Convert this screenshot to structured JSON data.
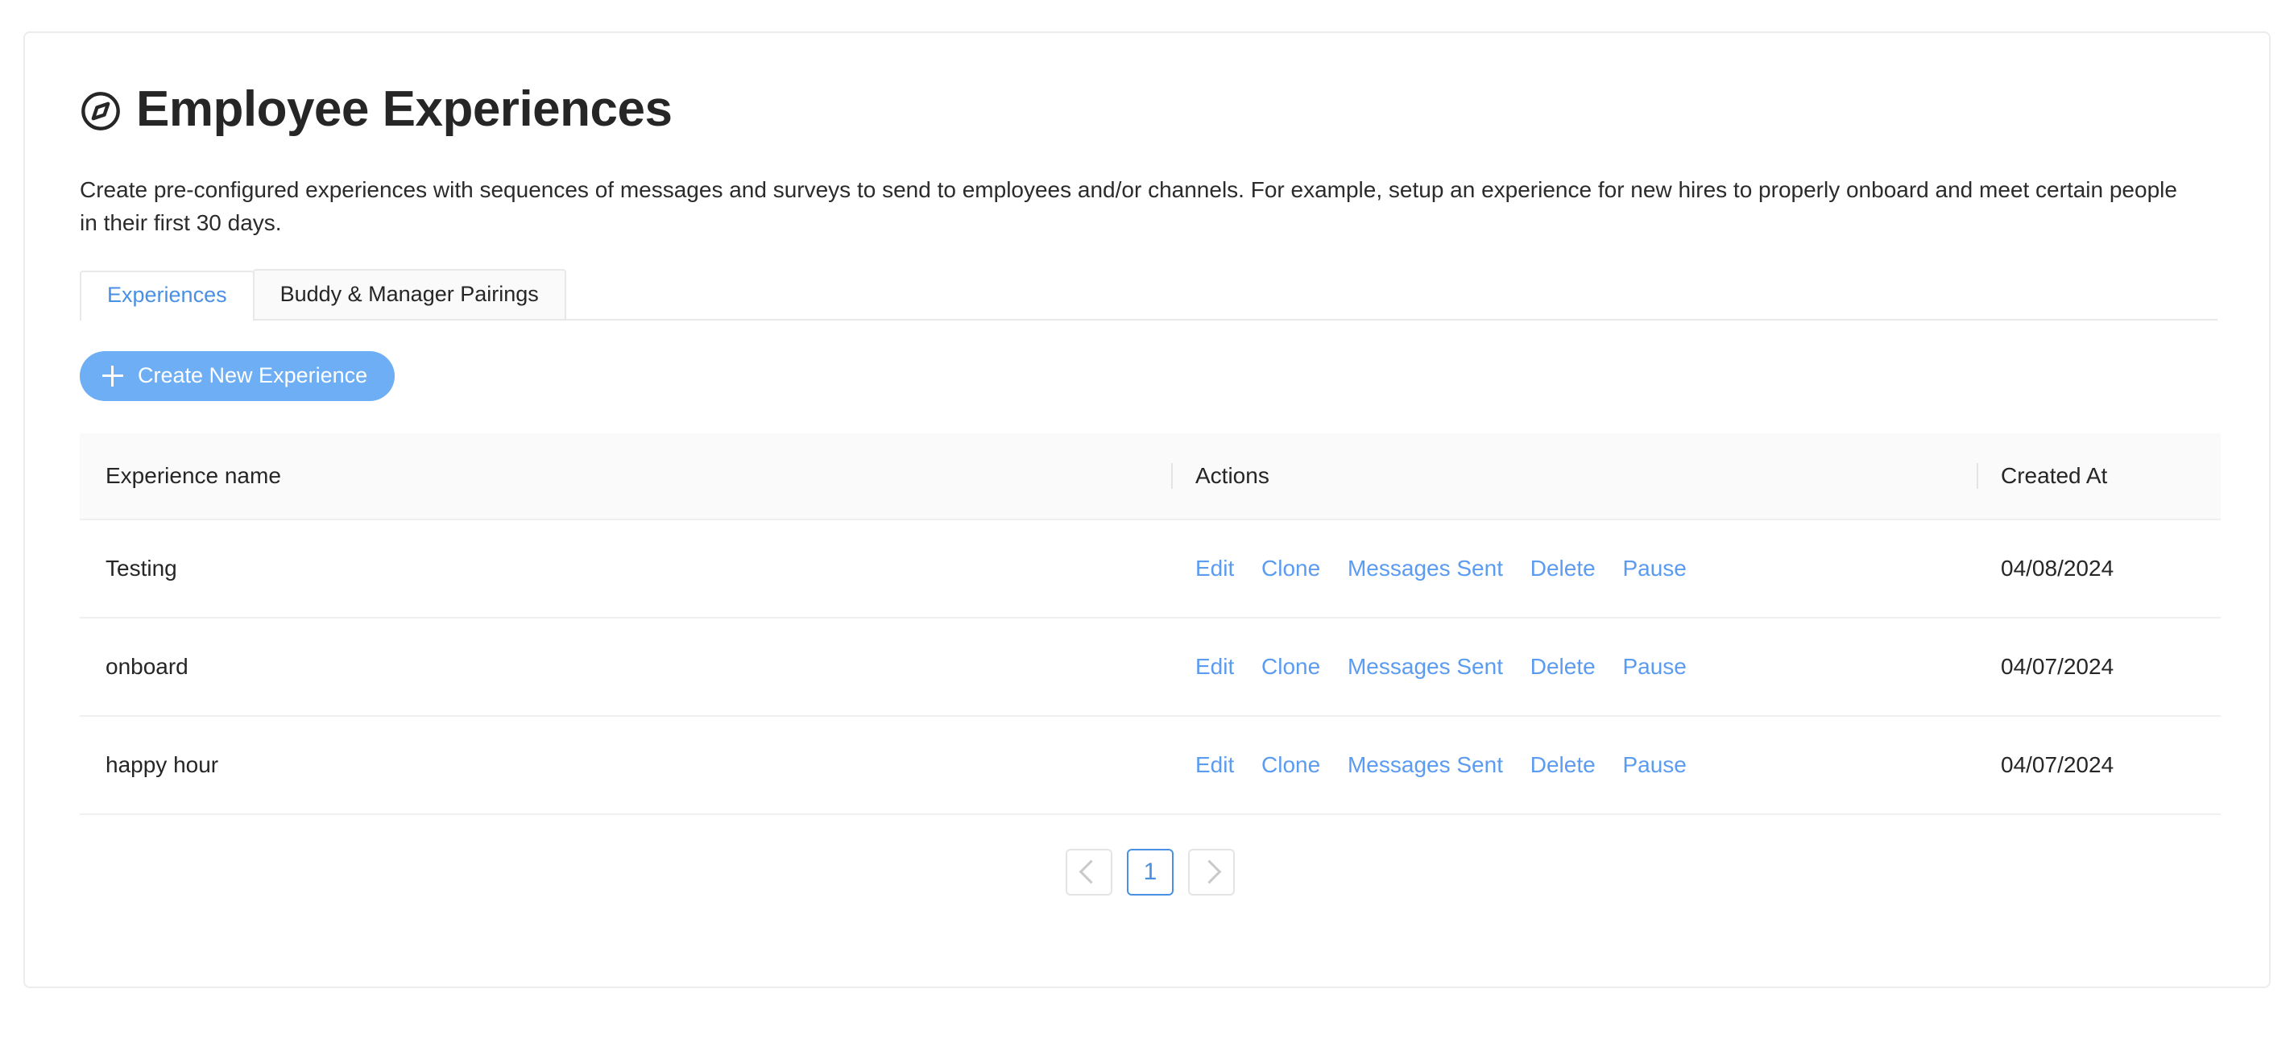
{
  "header": {
    "icon": "compass-icon",
    "title": "Employee Experiences",
    "description": "Create pre-configured experiences with sequences of messages and surveys to send to employees and/or channels. For example, setup an experience for new hires to properly onboard and meet certain people in their first 30 days."
  },
  "tabs": [
    {
      "label": "Experiences",
      "active": true
    },
    {
      "label": "Buddy & Manager Pairings",
      "active": false
    }
  ],
  "toolbar": {
    "create_label": "Create New Experience",
    "create_icon": "plus-icon"
  },
  "table": {
    "columns": [
      "Experience name",
      "Actions",
      "Created At"
    ],
    "action_labels": [
      "Edit",
      "Clone",
      "Messages Sent",
      "Delete",
      "Pause"
    ],
    "rows": [
      {
        "name": "Testing",
        "created_at": "04/08/2024"
      },
      {
        "name": "onboard",
        "created_at": "04/07/2024"
      },
      {
        "name": "happy hour",
        "created_at": "04/07/2024"
      }
    ]
  },
  "pagination": {
    "prev_icon": "chevron-left-icon",
    "next_icon": "chevron-right-icon",
    "current_page": "1"
  },
  "colors": {
    "accent": "#4a90e2",
    "link": "#5b9bf0",
    "button": "#6daef4",
    "border": "#e8e8e8",
    "header_bg": "#fafafa"
  }
}
